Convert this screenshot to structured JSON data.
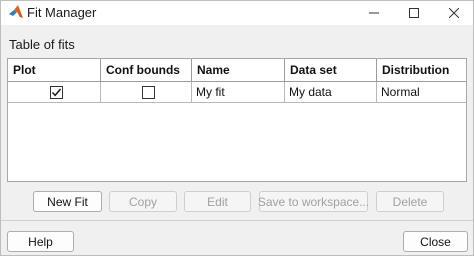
{
  "window": {
    "title": "Fit Manager"
  },
  "section": {
    "label": "Table of fits"
  },
  "table": {
    "headers": [
      "Plot",
      "Conf bounds",
      "Name",
      "Data set",
      "Distribution"
    ],
    "rows": [
      {
        "plot": true,
        "conf_bounds": false,
        "name": "My fit",
        "data_set": "My data",
        "distribution": "Normal"
      }
    ]
  },
  "actions": {
    "new_fit": "New Fit",
    "copy": "Copy",
    "edit": "Edit",
    "save_to_workspace": "Save to workspace...",
    "delete": "Delete"
  },
  "footer": {
    "help": "Help",
    "close": "Close"
  },
  "icons": {
    "app": "matlab-logo-icon",
    "minimize": "minimize-icon",
    "maximize": "maximize-icon",
    "close": "close-icon"
  },
  "colors": {
    "matlab_orange": "#e0601b",
    "matlab_blue": "#2f7fb5",
    "disabled_text": "#a0a0a0"
  }
}
